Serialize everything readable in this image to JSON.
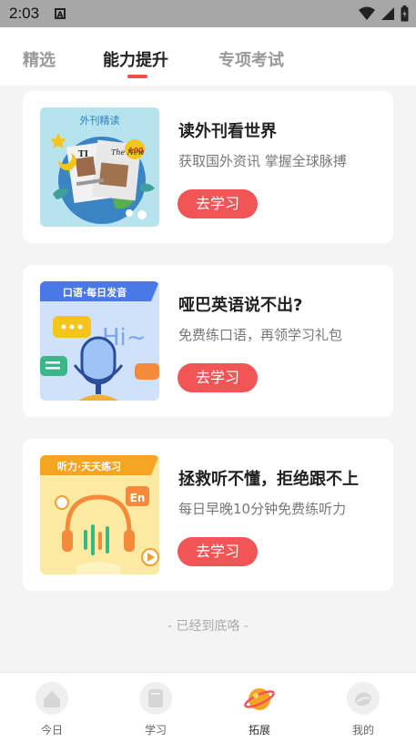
{
  "status_bar": {
    "time": "2:03",
    "notification_icon": "A"
  },
  "tabs": [
    {
      "label": "精选",
      "active": false
    },
    {
      "label": "能力提升",
      "active": true
    },
    {
      "label": "专项考试",
      "active": false
    }
  ],
  "cards": [
    {
      "title": "读外刊看世界",
      "desc": "获取国外资讯 掌握全球脉搏",
      "button": "去学习",
      "thumb_caption": "外刊精读",
      "thumb_paper_text": "The New",
      "thumb_badge": "100"
    },
    {
      "title": "哑巴英语说不出?",
      "desc": "免费练口语，再领学习礼包",
      "button": "去学习",
      "thumb_caption": "口语·每日发音",
      "thumb_hi": "Hi~"
    },
    {
      "title": "拯救听不懂，拒绝跟不上",
      "desc": "每日早晚10分钟免费练听力",
      "button": "去学习",
      "thumb_caption": "听力·天天练习",
      "thumb_badge": "En"
    }
  ],
  "end_note": "- 已经到底咯 -",
  "nav": [
    {
      "label": "今日",
      "icon": "home-icon",
      "active": false
    },
    {
      "label": "学习",
      "icon": "study-icon",
      "active": false
    },
    {
      "label": "拓展",
      "icon": "planet-icon",
      "active": true
    },
    {
      "label": "我的",
      "icon": "profile-icon",
      "active": false
    }
  ],
  "colors": {
    "accent": "#f25555",
    "tab_underline": "#f24d4d"
  }
}
